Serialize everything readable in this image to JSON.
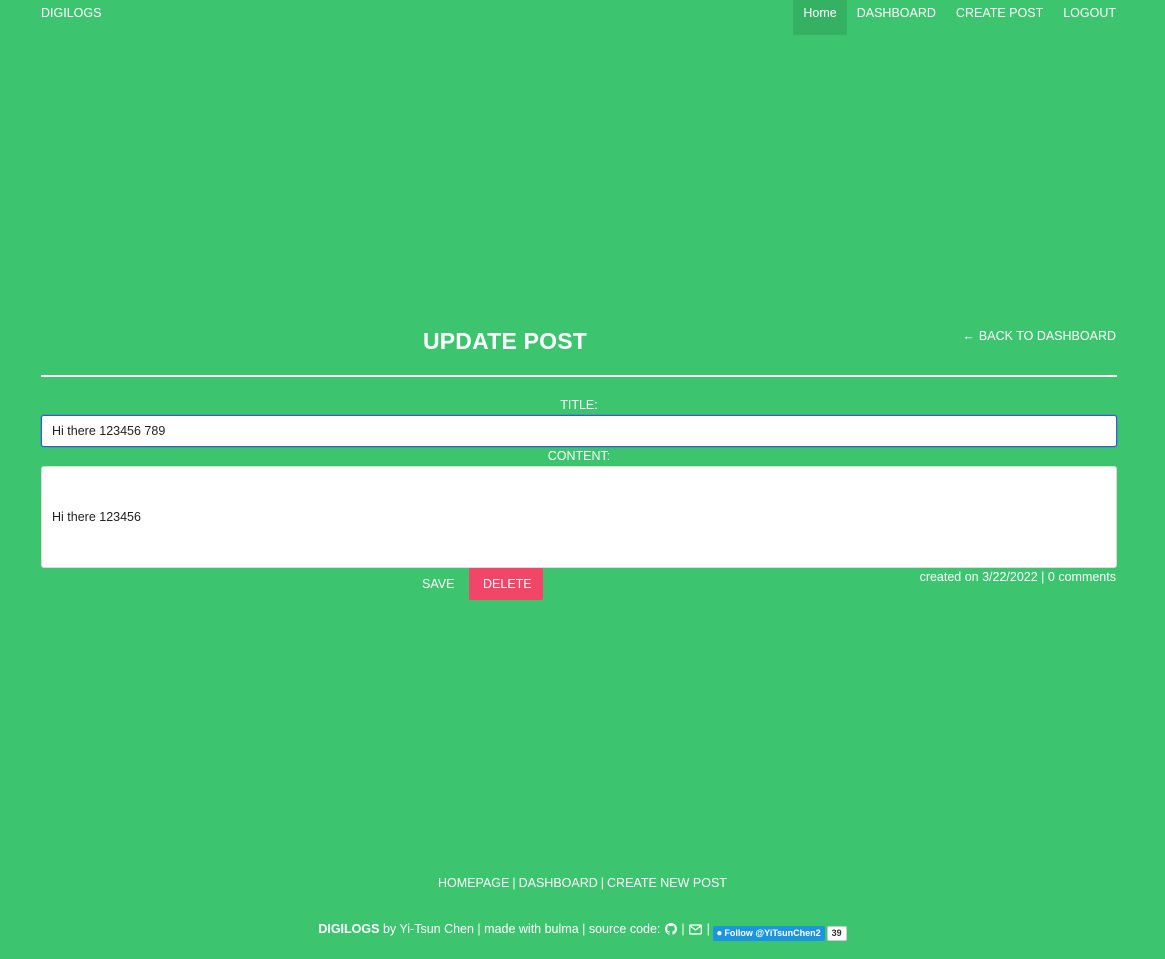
{
  "navbar": {
    "brand": "DIGILOGS",
    "items": [
      {
        "label": "Home",
        "active": true
      },
      {
        "label": "DASHBOARD",
        "active": false
      },
      {
        "label": "CREATE POST",
        "active": false
      },
      {
        "label": "LOGOUT",
        "active": false
      }
    ]
  },
  "page": {
    "title": "UPDATE POST",
    "back_link": "BACK TO DASHBOARD",
    "back_icon": "arrow-left-icon"
  },
  "form": {
    "title_label": "TITLE:",
    "title_value": "Hi there 123456 789",
    "content_label": "CONTENT:",
    "content_value": "Hi there 123456",
    "save_label": "SAVE",
    "delete_label": "DELETE"
  },
  "meta": {
    "text": "created on 3/22/2022 | 0 comments"
  },
  "footer": {
    "links": [
      "HOMEPAGE",
      "DASHBOARD",
      "CREATE NEW POST"
    ],
    "separator": "|",
    "credit_brand": "DIGILOGS",
    "credit_text": "by Yi-Tsun Chen | made with bulma | source code:",
    "pipe": "|",
    "twitter_label": "Follow @YiTsunChen2",
    "twitter_count": "39",
    "icons": [
      "github-icon",
      "envelope-icon",
      "twitter-icon"
    ]
  },
  "colors": {
    "background": "#3cc46e",
    "active_nav": "#34b163",
    "delete": "#f14668",
    "input_focus": "#3e56d6"
  }
}
